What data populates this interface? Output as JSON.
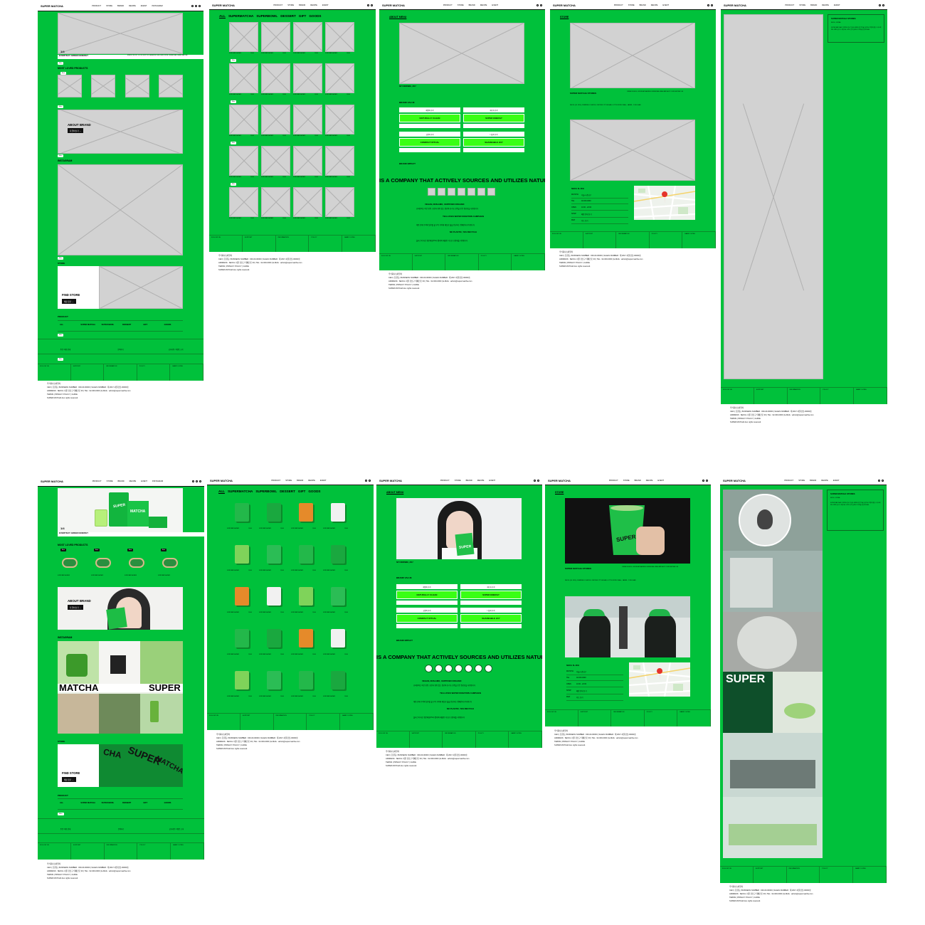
{
  "brand": {
    "logo": "SUPER MATCHA",
    "accent": "#00c13b",
    "neon": "#39ff14"
  },
  "nav": {
    "items": [
      "PRODUCT",
      "STORE",
      "BRAND",
      "RECIPE",
      "EVENT",
      "INSTAGRAM"
    ]
  },
  "home": {
    "hero_counter": "1/4",
    "hero_title": "EVERYDAY GREEN ENERGY",
    "hero_caption": "ENERGY BOOST, FOCUS SUPPORT, BALANCED WELLNESS FROM CEREMONIAL GRADE MATCHA",
    "most_loved": "MOST LOVED PRODUCTS",
    "about_brand": "ABOUT BRAND",
    "about_btn": "더 알아보기 →",
    "instagram": "INSTAGRAM",
    "instagram_words": [
      "MATCHA",
      "SUPER"
    ],
    "store": "STORE",
    "find_store": "FIND STORE",
    "find_btn": "매장 찾기 →",
    "product": "PRODUCT",
    "product_tabs": [
      "ALL",
      "SUPER MATCHA",
      "SUPER BOWL",
      "DESSERT",
      "GIFT",
      "GOODS"
    ],
    "product_more": "More",
    "notice_items": [
      "주문 / 배송 안내",
      "문의하기",
      "공지사항 / 이벤트 소식"
    ]
  },
  "shop": {
    "tabs": [
      "ALL",
      "SUPERMATCHA",
      "SUPERBOWL",
      "DESSERT",
      "GIFT",
      "GOODS"
    ],
    "item_name": "SUPER MATCHA PACK",
    "item_price": "19,000"
  },
  "about": {
    "title": "ABOUT MENU",
    "caption": "SKY MORNING_2017",
    "brand_value": "BRAND VALUE",
    "values": [
      {
        "k": "매일의 가치",
        "v": "NATURALLY CLEAN"
      },
      {
        "k": "에너지 가치",
        "v": "SUPER ENERGY"
      },
      {
        "k": "공유의 가치",
        "v": "COMPACT RITUAL"
      },
      {
        "k": "나눔의 가치",
        "v": "SHAREABLE JOY"
      }
    ],
    "brand_impact": "BRAND IMPACT",
    "marquee": "IS A COMPANY THAT ACTIVELY SOURCES AND UTILIZES NATURAL RAW INGRE",
    "impact1_title": "VEGAN, NON-GMO, CERTIFIED ORGANIC",
    "impact1_text": "슈퍼말차는 비건 인증, 유전자 변형 없는 원료와 유기농 인증을 받은 원료만을 사용합니다",
    "impact2_title": "TEA LOVES WATER DONATION CAMPAIGN",
    "impact2_text": "제품 판매 수익의 일부를 물 부족 지역에 깨끗한 물을 전달하는 캠페인에 기부합니다",
    "impact3_title": "NO PLASTIC, YES RECYCLE",
    "impact3_text": "플라스틱 대신 생분해성(PLA) 빨대와 재활용 가능한 포장재를 사용합니다"
  },
  "store": {
    "title": "STORE",
    "stores_title": "SUPER MATCHA STORES",
    "stores_desc": "OPENED IN SEOUL, SUPER MATCHA BRINGS CEREMONIAL GRADE MATCHA TO YOUR EVERYDAY LIFE",
    "locations": "SEOUL (SL 2020), STARFIELD SUWON, CENTUM CITY BUSAN, LOTTE WORLD MALL, JAMSIL, YONG SAN",
    "branch": "SEOUL SL 2019",
    "rows": [
      [
        "MATCHA",
        "서울시 강남구"
      ],
      [
        "TEL",
        "02-000-0000"
      ],
      [
        "OPEN",
        "10:00 - 22:00"
      ],
      [
        "SHOP",
        "매장 안내 보기"
      ],
      [
        "MAP",
        "지도 보기"
      ]
    ]
  },
  "detail": {
    "title": "SUPER MATCHA STORES",
    "sub": "SEOUL, KOREA",
    "body": "SUPER MATCHA는 자연에서 얻은 최상급 세레모니얼 말차를 일상에서 가볍게 즐길 수 있도록 만든 브랜드입니다. 매장에서 신선한 말차 음료와 디저트를 경험해 보세요."
  },
  "footer": {
    "cols": [
      "FOLLOW US",
      "SUPPORT",
      "INFORMATION",
      "POLICY",
      "FAMILY SITES"
    ],
    "lines": [
      "주식회사슈퍼말차",
      "CEO | 홍길동 | BUSINESS NUMBER : 000-00-00000 | SALES NUMBER : 제 2017-서울강남-00000호",
      "ADDRESS : SEOUL 서울 강남구 테헤란로 00 | TEL : 02-000-0000 | E-MAIL : admin@supermatcha.com",
      "TERMS | PRIVACY POLICY | GUIDE",
      "SUPER MATCHA ALL rights reserved."
    ]
  }
}
